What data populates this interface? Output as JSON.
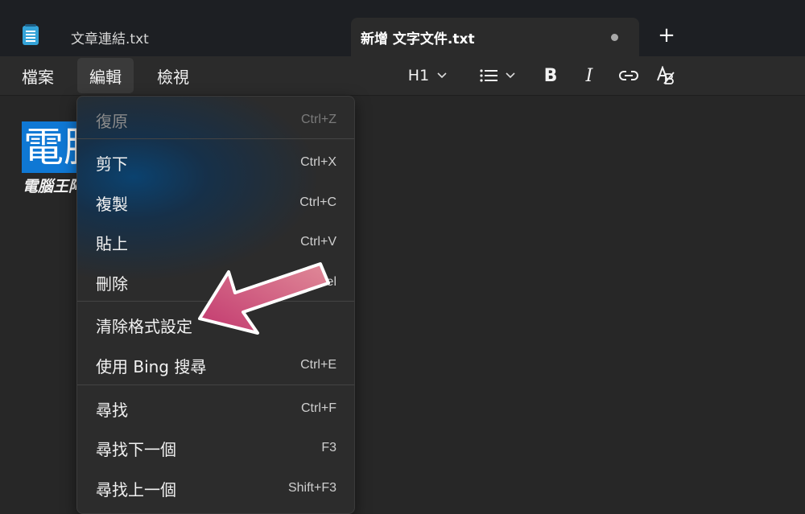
{
  "tabs": [
    {
      "title": "文章連結.txt",
      "active": false
    },
    {
      "title": "新增 文字文件.txt",
      "active": true,
      "unsaved": true
    }
  ],
  "new_tab_label": "+",
  "menubar": {
    "file": "檔案",
    "edit": "編輯",
    "view": "檢視"
  },
  "toolbar": {
    "heading": "H1",
    "bold": "B",
    "italic": "I",
    "spellcheck": "A"
  },
  "document": {
    "selected_text": "電腦",
    "subtitle": "電腦王阿達"
  },
  "edit_menu": {
    "items": [
      {
        "label": "復原",
        "shortcut": "Ctrl+Z",
        "enabled": false
      },
      {
        "label": "剪下",
        "shortcut": "Ctrl+X",
        "enabled": true
      },
      {
        "label": "複製",
        "shortcut": "Ctrl+C",
        "enabled": true
      },
      {
        "label": "貼上",
        "shortcut": "Ctrl+V",
        "enabled": true
      },
      {
        "label": "刪除",
        "shortcut": "Del",
        "enabled": true
      },
      {
        "label": "清除格式設定",
        "shortcut": "",
        "enabled": true
      },
      {
        "label": "使用 Bing 搜尋",
        "shortcut": "Ctrl+E",
        "enabled": true
      },
      {
        "label": "尋找",
        "shortcut": "Ctrl+F",
        "enabled": true
      },
      {
        "label": "尋找下一個",
        "shortcut": "F3",
        "enabled": true
      },
      {
        "label": "尋找上一個",
        "shortcut": "Shift+F3",
        "enabled": true
      }
    ]
  },
  "colors": {
    "accent": "#0f78d4",
    "arrow": "#c2386e"
  }
}
